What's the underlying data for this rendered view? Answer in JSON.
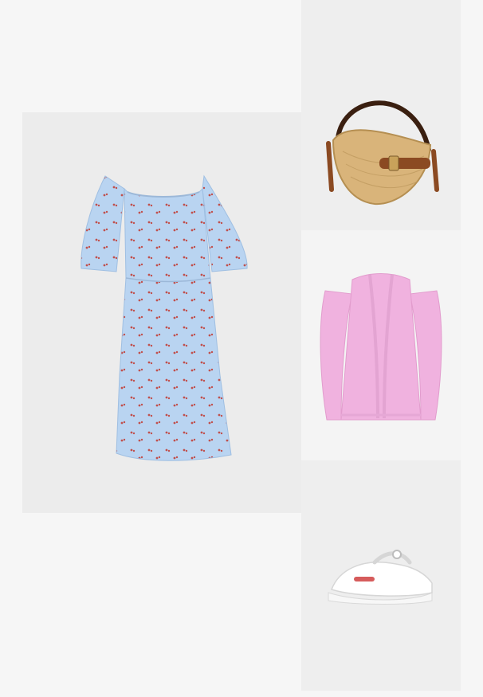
{
  "board": {
    "background_color": "#f6f6f6"
  },
  "items": [
    {
      "id": "dress",
      "icon": "dress-image",
      "colors": {
        "fabric": "#b9d4f1",
        "dots": "#c0504d"
      }
    },
    {
      "id": "bag",
      "icon": "straw-bag-image",
      "colors": {
        "straw": "#d9b47a",
        "leather": "#8b4a22"
      }
    },
    {
      "id": "cardigan",
      "icon": "cardigan-image",
      "colors": {
        "knit": "#f0b2df"
      }
    },
    {
      "id": "shoe",
      "icon": "sneaker-image",
      "colors": {
        "upper": "#ffffff",
        "accent": "#d24a4a"
      }
    }
  ]
}
